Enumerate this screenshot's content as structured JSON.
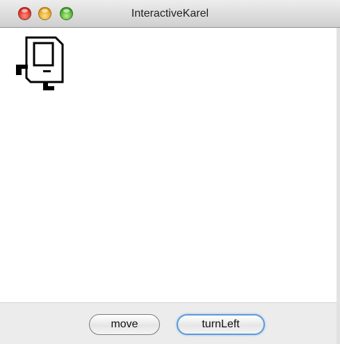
{
  "window": {
    "title": "InteractiveKarel"
  },
  "canvas": {
    "karel_icon": "karel-robot-icon"
  },
  "controls": {
    "move_label": "move",
    "turn_left_label": "turnLeft"
  }
}
